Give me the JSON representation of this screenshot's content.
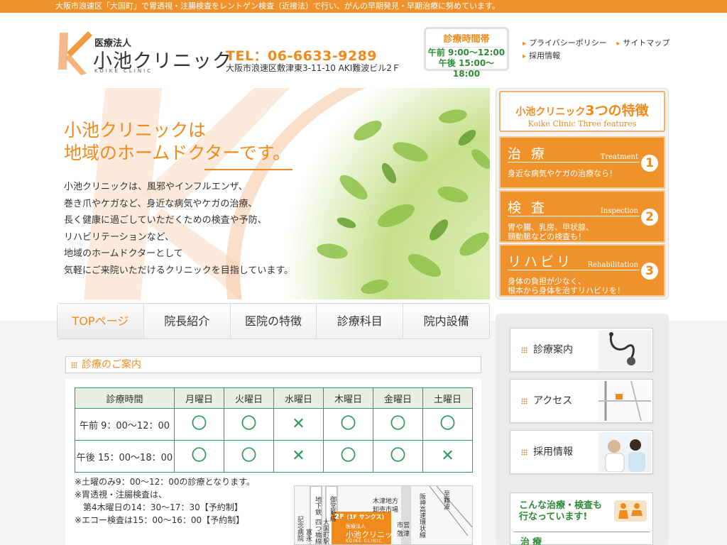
{
  "topbar": {
    "text": "大阪市浪速区「大国町」で胃透視・注腸検査をレントゲン検査（近接法）で行い、がんの早期発見・早期治療に努めています。"
  },
  "header": {
    "corp": "医療法人",
    "clinic_name": "小池クリニック",
    "clinic_roman": "KOIKE CLINIC",
    "tel": "TEL：06-6633-9289",
    "address": "大阪市浪速区敷津東3-11-10 AKI難波ビル2Ｆ",
    "hours": {
      "title": "診療時間帯",
      "am": "午前 9:00〜12:00",
      "pm": "午後 15:00〜18:00"
    },
    "links": [
      "プライバシーポリシー",
      "サイトマップ",
      "採用情報"
    ]
  },
  "hero": {
    "title_line1": "小池クリニックは",
    "title_line2": "地域のホームドクターです。",
    "text": [
      "小池クリニックは、風邪やインフルエンザ、",
      "巻き爪やケガなど、身近な病気やケガの治療、",
      "長く健康に過ごしていただくための検査や予防、",
      "リハビリテーションなど、",
      "地域のホームドクターとして",
      "気軽にご来院いただけるクリニックを目指しています。"
    ]
  },
  "nav": [
    "TOPページ",
    "院長紹介",
    "医院の特徴",
    "診療科目",
    "院内設備"
  ],
  "features": {
    "head_prefix": "小池クリニック",
    "head_main": "3つの特徴",
    "head_en": "Koike Clinic Three features",
    "items": [
      {
        "title": "治 療",
        "en": "Treatment",
        "num": "1",
        "desc1": "身近な病気やケガの治療なら！",
        "desc2": ""
      },
      {
        "title": "検 査",
        "en": "Inspection",
        "num": "2",
        "desc1": "胃や腸、乳房、甲状腺、",
        "desc2": "頸動脈などの検査も！"
      },
      {
        "title": "リハビリ",
        "en": "Rehabilitation",
        "num": "3",
        "desc1": "身体の負担が少なく、",
        "desc2": "根本から身体を治すリハビリを！"
      }
    ]
  },
  "schedule": {
    "heading": "診療のご案内",
    "headers": [
      "診療時間",
      "月曜日",
      "火曜日",
      "水曜日",
      "木曜日",
      "金曜日",
      "土曜日"
    ],
    "rows": [
      {
        "label": "午前 9：00〜12：00",
        "marks": [
          "〇",
          "〇",
          "✕",
          "〇",
          "〇",
          "〇"
        ]
      },
      {
        "label": "午後 15：00〜18：00",
        "marks": [
          "〇",
          "〇",
          "✕",
          "〇",
          "〇",
          "✕"
        ]
      }
    ],
    "notes": [
      "※土曜のみ9：00〜12：00の診療となります。",
      "※胃透視・注腸検査は、",
      "　第4木曜日の14：30〜17：30【予約制】",
      "※エコー検査は15：00〜16：00【予約制】"
    ]
  },
  "map": {
    "labels": [
      "地下鉄",
      "四つ橋線",
      "大国町駅",
      "御堂筋線",
      "富永",
      "記念病院",
      "木津地方",
      "卸売市場",
      "阪神高速環状線",
      "市営",
      "敷津",
      "至難波"
    ],
    "badge_floor": "2F",
    "badge_floor_note": "(1F サンクス)",
    "badge_corp": "医療法人",
    "badge_name": "小池クリニック",
    "badge_roman": "KOIKE CLINIC"
  },
  "side_cards": [
    "診療案内",
    "アクセス",
    "採用情報"
  ],
  "treatment_box": {
    "line1": "こんな治療・検査も",
    "line2": "行なっています!",
    "sub": "治療"
  }
}
